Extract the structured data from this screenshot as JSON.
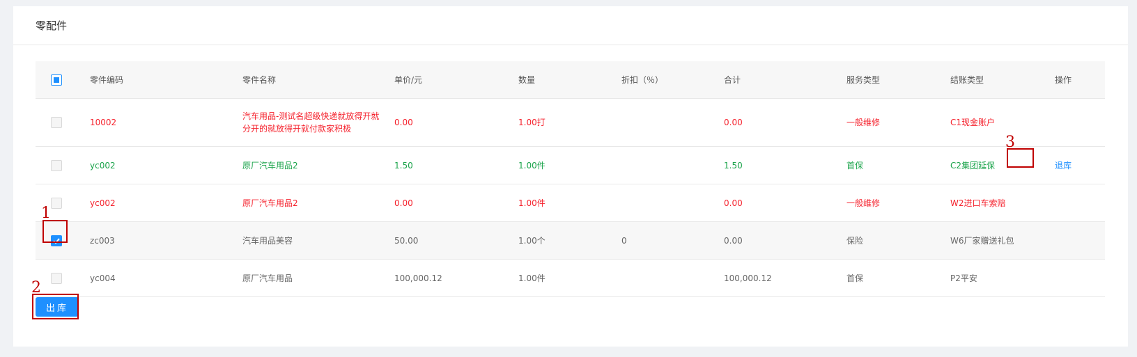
{
  "card": {
    "title": "零配件"
  },
  "table": {
    "headers": {
      "code": "零件编码",
      "name": "零件名称",
      "price": "单价/元",
      "qty": "数量",
      "discount": "折扣（％）",
      "total": "合计",
      "service": "服务类型",
      "account": "结账类型",
      "op": "操作"
    },
    "rows": [
      {
        "code": "10002",
        "name": "汽车用品-测试名超级快递就放得开就分开的就放得开就付款家积极",
        "price": "0.00",
        "qty": "1.00打",
        "discount": "",
        "total": "0.00",
        "service": "一般维修",
        "account": "C1现金账户",
        "op": "",
        "color": "#f5222d",
        "checked": false
      },
      {
        "code": "yc002",
        "name": "原厂汽车用品2",
        "price": "1.50",
        "qty": "1.00件",
        "discount": "",
        "total": "1.50",
        "service": "首保",
        "account": "C2集团延保",
        "op": "退库",
        "color": "#1aa34a",
        "checked": false
      },
      {
        "code": "yc002",
        "name": "原厂汽车用品2",
        "price": "0.00",
        "qty": "1.00件",
        "discount": "",
        "total": "0.00",
        "service": "一般维修",
        "account": "W2进口车索赔",
        "op": "",
        "color": "#f5222d",
        "checked": false
      },
      {
        "code": "zc003",
        "name": "汽车用品美容",
        "price": "50.00",
        "qty": "1.00个",
        "discount": "0",
        "total": "0.00",
        "service": "保险",
        "account": "W6厂家赠送礼包",
        "op": "",
        "color": "#666666",
        "checked": true
      },
      {
        "code": "yc004",
        "name": "原厂汽车用品",
        "price": "100,000.12",
        "qty": "1.00件",
        "discount": "",
        "total": "100,000.12",
        "service": "首保",
        "account": "P2平安",
        "op": "",
        "color": "#666666",
        "checked": false
      }
    ]
  },
  "actions": {
    "outbound_label": "出库"
  },
  "annotations": [
    "1",
    "2",
    "3"
  ],
  "colors": {
    "primary": "#1e90ff",
    "danger": "#f5222d",
    "success": "#1aa34a",
    "annotation": "#c00000"
  }
}
